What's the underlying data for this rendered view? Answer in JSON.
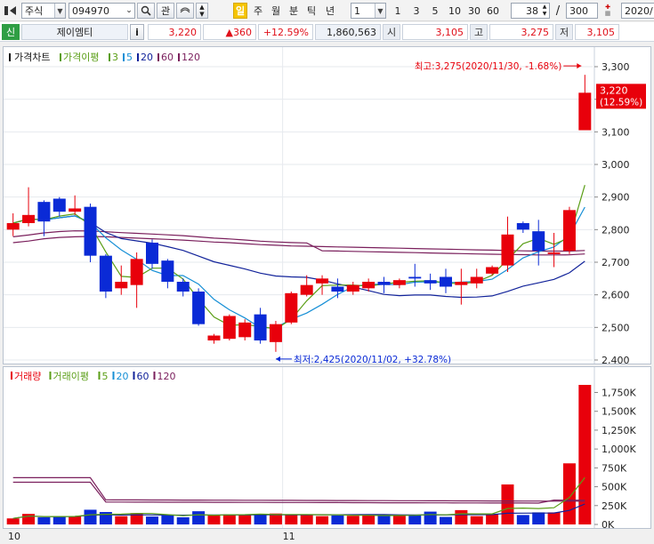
{
  "toolbar": {
    "market": "주식",
    "code": "094970",
    "btn_gwan": "관",
    "period_tabs": [
      "일",
      "주",
      "월",
      "분",
      "틱",
      "년"
    ],
    "interval_value": "1",
    "interval_buttons": [
      "1",
      "3",
      "5",
      "10",
      "30",
      "60"
    ],
    "count_value": "38",
    "slash": "/",
    "total_value": "300",
    "date_value": "2020/"
  },
  "quote": {
    "tag": "신",
    "name": "제이엠티",
    "info_btn": "i",
    "price": "3,220",
    "change": "▲360",
    "rate": "+12.59%",
    "volume": "1,860,563",
    "open_label": "시",
    "open": "3,105",
    "high_label": "고",
    "high": "3,275",
    "low_label": "저",
    "low": "3,105"
  },
  "colors": {
    "up": "#e8000b",
    "down": "#0a2ad6",
    "ma3": "#5a9e16",
    "ma5": "#168fd6",
    "ma20": "#12239a",
    "ma60": "#7a1f5c",
    "ma120": "#7a1f5c"
  },
  "price_panel": {
    "legend": [
      {
        "text": "가격차트",
        "color": "#111111"
      },
      {
        "text": "가격이평",
        "color": "#5a9e16"
      },
      {
        "text": "3",
        "color": "#5a9e16"
      },
      {
        "text": "5",
        "color": "#168fd6"
      },
      {
        "text": "20",
        "color": "#12239a"
      },
      {
        "text": "60",
        "color": "#7a1f5c"
      },
      {
        "text": "120",
        "color": "#7a1f5c"
      }
    ],
    "y_ticks": [
      "3,300",
      "3,200",
      "3,100",
      "3,000",
      "2,900",
      "2,800",
      "2,700",
      "2,600",
      "2,500",
      "2,400"
    ],
    "high_note": "최고:3,275(2020/11/30, -1.68%)",
    "low_note": "최저:2,425(2020/11/02, +32.78%)",
    "last_price": "3,220",
    "last_rate": "(12.59%)"
  },
  "volume_panel": {
    "legend": [
      {
        "text": "거래량",
        "color": "#e8000b"
      },
      {
        "text": "거래이평",
        "color": "#5a9e16"
      },
      {
        "text": "5",
        "color": "#5a9e16"
      },
      {
        "text": "20",
        "color": "#168fd6"
      },
      {
        "text": "60",
        "color": "#12239a"
      },
      {
        "text": "120",
        "color": "#7a1f5c"
      }
    ],
    "y_ticks": [
      "1,750K",
      "1,500K",
      "1,250K",
      "1,000K",
      "750K",
      "500K",
      "250K",
      "0K"
    ]
  },
  "x_labels": [
    "10",
    "11"
  ],
  "chart_data": {
    "type": "candlestick",
    "ylim": [
      2400,
      3300
    ],
    "candles": [
      {
        "o": 2800,
        "h": 2850,
        "l": 2780,
        "c": 2820
      },
      {
        "o": 2820,
        "h": 2930,
        "l": 2810,
        "c": 2845
      },
      {
        "o": 2885,
        "h": 2890,
        "l": 2780,
        "c": 2825
      },
      {
        "o": 2895,
        "h": 2900,
        "l": 2840,
        "c": 2855
      },
      {
        "o": 2855,
        "h": 2905,
        "l": 2845,
        "c": 2865
      },
      {
        "o": 2870,
        "h": 2880,
        "l": 2700,
        "c": 2720
      },
      {
        "o": 2720,
        "h": 2725,
        "l": 2590,
        "c": 2610
      },
      {
        "o": 2620,
        "h": 2690,
        "l": 2600,
        "c": 2640
      },
      {
        "o": 2630,
        "h": 2730,
        "l": 2560,
        "c": 2710
      },
      {
        "o": 2760,
        "h": 2770,
        "l": 2680,
        "c": 2695
      },
      {
        "o": 2705,
        "h": 2710,
        "l": 2620,
        "c": 2640
      },
      {
        "o": 2640,
        "h": 2650,
        "l": 2595,
        "c": 2610
      },
      {
        "o": 2610,
        "h": 2620,
        "l": 2505,
        "c": 2510
      },
      {
        "o": 2460,
        "h": 2480,
        "l": 2450,
        "c": 2475
      },
      {
        "o": 2465,
        "h": 2540,
        "l": 2460,
        "c": 2535
      },
      {
        "o": 2470,
        "h": 2525,
        "l": 2460,
        "c": 2515
      },
      {
        "o": 2540,
        "h": 2560,
        "l": 2450,
        "c": 2460
      },
      {
        "o": 2455,
        "h": 2520,
        "l": 2425,
        "c": 2510
      },
      {
        "o": 2515,
        "h": 2610,
        "l": 2510,
        "c": 2605
      },
      {
        "o": 2600,
        "h": 2660,
        "l": 2595,
        "c": 2630
      },
      {
        "o": 2635,
        "h": 2660,
        "l": 2600,
        "c": 2650
      },
      {
        "o": 2625,
        "h": 2650,
        "l": 2590,
        "c": 2610
      },
      {
        "o": 2610,
        "h": 2640,
        "l": 2600,
        "c": 2630
      },
      {
        "o": 2620,
        "h": 2650,
        "l": 2610,
        "c": 2640
      },
      {
        "o": 2640,
        "h": 2655,
        "l": 2605,
        "c": 2630
      },
      {
        "o": 2630,
        "h": 2650,
        "l": 2620,
        "c": 2645
      },
      {
        "o": 2655,
        "h": 2695,
        "l": 2625,
        "c": 2650
      },
      {
        "o": 2645,
        "h": 2665,
        "l": 2615,
        "c": 2635
      },
      {
        "o": 2655,
        "h": 2680,
        "l": 2605,
        "c": 2625
      },
      {
        "o": 2630,
        "h": 2680,
        "l": 2570,
        "c": 2640
      },
      {
        "o": 2635,
        "h": 2680,
        "l": 2620,
        "c": 2655
      },
      {
        "o": 2665,
        "h": 2690,
        "l": 2660,
        "c": 2685
      },
      {
        "o": 2690,
        "h": 2840,
        "l": 2670,
        "c": 2785
      },
      {
        "o": 2820,
        "h": 2825,
        "l": 2790,
        "c": 2800
      },
      {
        "o": 2795,
        "h": 2830,
        "l": 2690,
        "c": 2735
      },
      {
        "o": 2725,
        "h": 2790,
        "l": 2685,
        "c": 2730
      },
      {
        "o": 2735,
        "h": 2870,
        "l": 2725,
        "c": 2860
      },
      {
        "o": 3105,
        "h": 3275,
        "l": 3105,
        "c": 3220
      }
    ],
    "volume": [
      80,
      140,
      95,
      105,
      110,
      195,
      165,
      110,
      150,
      105,
      120,
      95,
      175,
      120,
      135,
      125,
      130,
      145,
      125,
      135,
      110,
      120,
      115,
      125,
      120,
      115,
      130,
      170,
      100,
      190,
      110,
      130,
      530,
      125,
      160,
      160,
      810,
      1850
    ],
    "volume_ylim": [
      0,
      1850
    ]
  }
}
